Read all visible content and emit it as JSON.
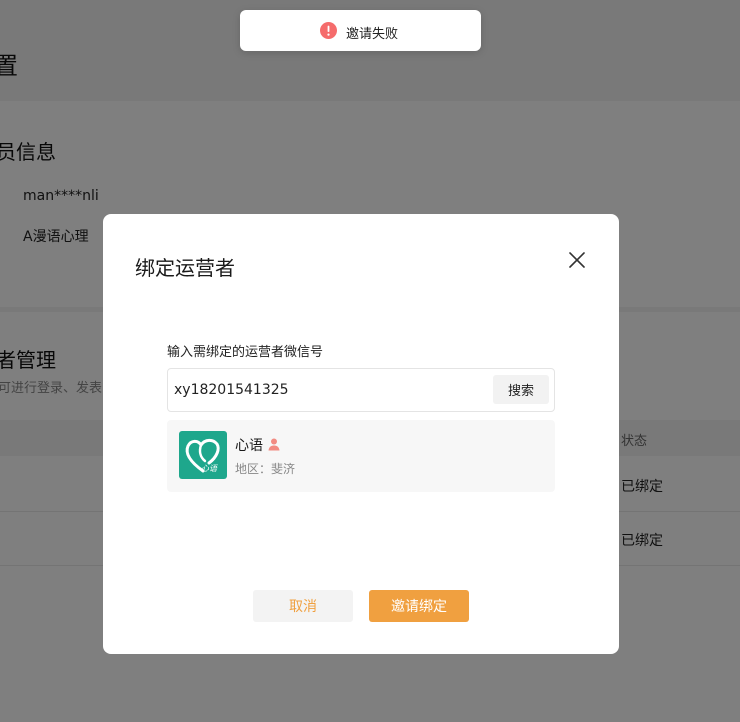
{
  "page": {
    "title": "置",
    "member_section": {
      "title": "员信息",
      "account": "man****nli",
      "org_name": "A漫语心理"
    },
    "operator_section": {
      "title": "者管理",
      "description": "可进行登录、发表",
      "table": {
        "status_header": "状态",
        "rows": [
          {
            "status": "已绑定"
          },
          {
            "status": "已绑定"
          }
        ]
      }
    }
  },
  "modal": {
    "title": "绑定运营者",
    "field_label": "输入需绑定的运营者微信号",
    "search_value": "xy18201541325",
    "search_button": "搜索",
    "result": {
      "name": "心语",
      "avatar_text": "心语",
      "region": "地区：斐济"
    },
    "cancel_button": "取消",
    "confirm_button": "邀请绑定"
  },
  "toast": {
    "message": "邀请失败",
    "icon": "error-icon"
  },
  "colors": {
    "accent": "#f0a040",
    "error": "#f56c6c",
    "avatar_bg": "#1ea78c",
    "person_icon": "#f28b82"
  }
}
